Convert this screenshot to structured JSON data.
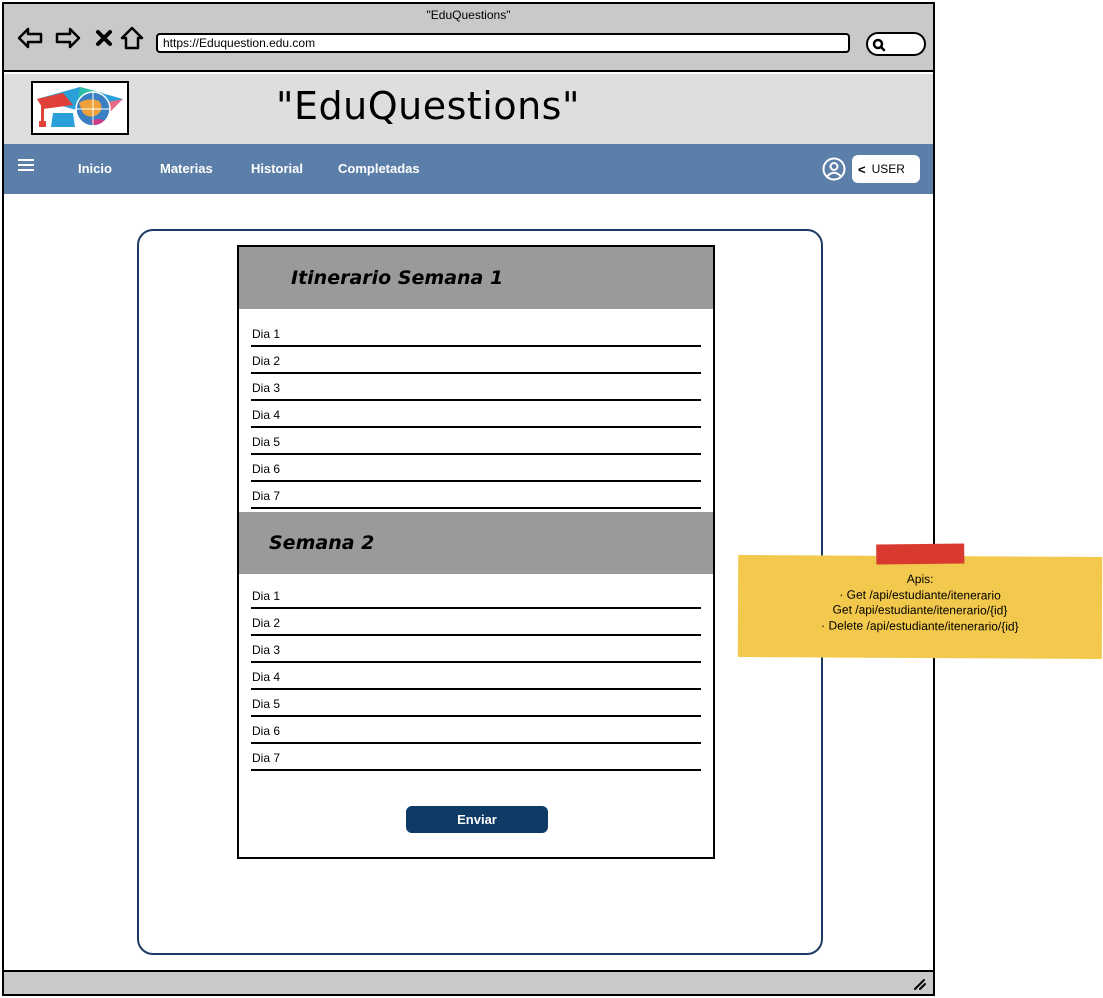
{
  "browser": {
    "window_title": "\"EduQuestions\"",
    "url": "https://Eduquestion.edu.com"
  },
  "site": {
    "title": "\"EduQuestions\""
  },
  "navbar": {
    "links": [
      "Inicio",
      "Materias",
      "Historial",
      "Completadas"
    ],
    "user_label": "USER"
  },
  "itinerary": {
    "weeks": [
      {
        "title": "Itinerario Semana 1",
        "days": [
          "Dia 1",
          "Dia 2",
          "Dia 3",
          "Dia 4",
          "Dia 5",
          "Dia 6",
          "Dia 7"
        ]
      },
      {
        "title": "Semana 2",
        "days": [
          "Dia 1",
          "Dia 2",
          "Dia 3",
          "Dia 4",
          "Dia 5",
          "Dia 6",
          "Dia 7"
        ]
      }
    ],
    "send_label": "Enviar"
  },
  "note": {
    "title": "Apis:",
    "lines": [
      "·   Get /api/estudiante/itenerario",
      "Get /api/estudiante/itenerario/{id}",
      "·   Delete /api/estudiante/itenerario/{id}"
    ]
  },
  "colors": {
    "navbar": "#5b7fa8",
    "send_button": "#0e3a66",
    "week_header": "#9a9a9a",
    "sticky_note": "#f2c94c",
    "sticky_tape": "#d93a2f"
  }
}
